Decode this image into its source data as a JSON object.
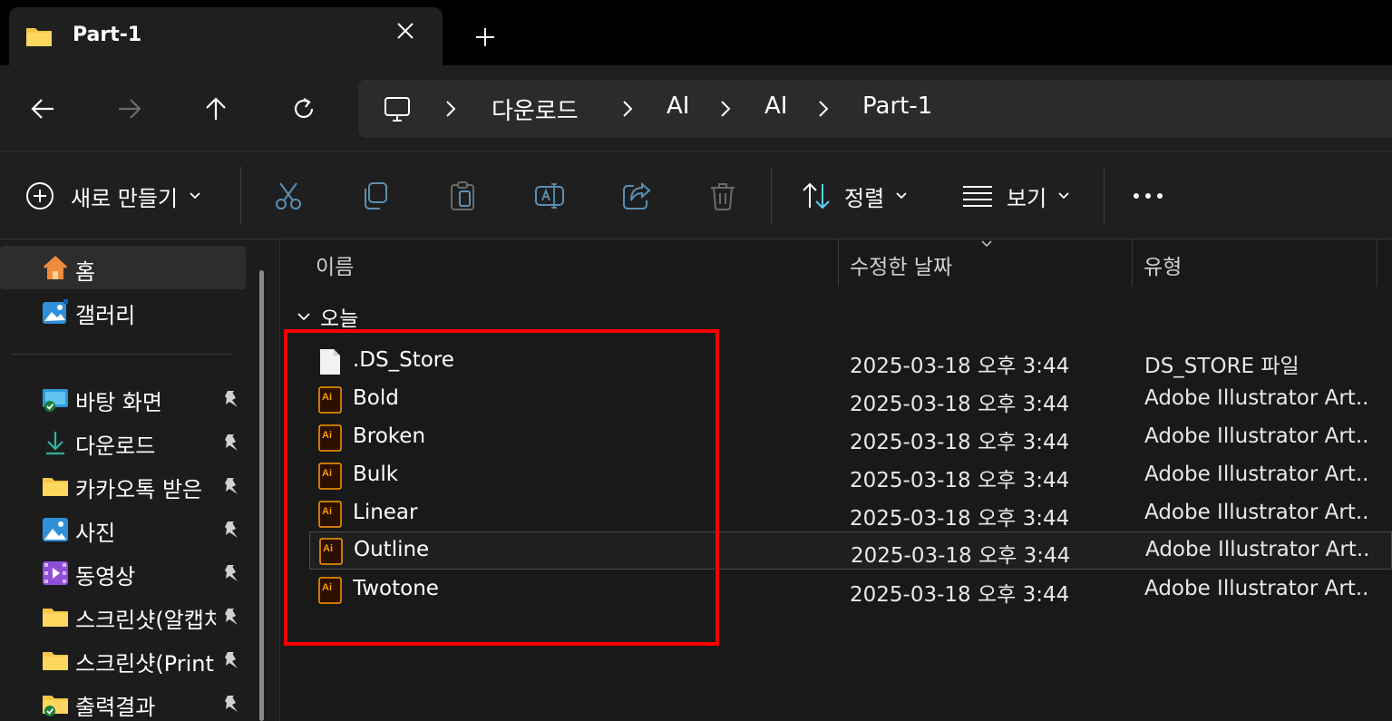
{
  "tab": {
    "title": "Part-1"
  },
  "address": {
    "crumbs": [
      "다운로드",
      "AI",
      "AI",
      "Part-1"
    ]
  },
  "toolbar": {
    "new_label": "새로 만들기",
    "sort_label": "정렬",
    "view_label": "보기"
  },
  "sidebar": {
    "items": [
      {
        "label": "홈",
        "icon": "home-icon"
      },
      {
        "label": "갤러리",
        "icon": "gallery-icon"
      },
      {
        "label": "바탕 화면",
        "icon": "desktop-icon"
      },
      {
        "label": "다운로드",
        "icon": "download-icon"
      },
      {
        "label": "카카오톡 받은",
        "icon": "folder-icon"
      },
      {
        "label": "사진",
        "icon": "pictures-icon"
      },
      {
        "label": "동영상",
        "icon": "videos-icon"
      },
      {
        "label": "스크린샷(알캡처",
        "icon": "folder-icon"
      },
      {
        "label": "스크린샷(Print",
        "icon": "folder-icon"
      },
      {
        "label": "출력결과",
        "icon": "folder-synced-icon"
      }
    ]
  },
  "columns": {
    "name": "이름",
    "date": "수정한 날짜",
    "type": "유형"
  },
  "group": {
    "label": "오늘"
  },
  "files": [
    {
      "name": ".DS_Store",
      "date": "2025-03-18 오후 3:44",
      "type": "DS_STORE 파일",
      "icon": "generic-file-icon"
    },
    {
      "name": "Bold",
      "date": "2025-03-18 오후 3:44",
      "type": "Adobe Illustrator Art...",
      "icon": "illustrator-file-icon"
    },
    {
      "name": "Broken",
      "date": "2025-03-18 오후 3:44",
      "type": "Adobe Illustrator Art...",
      "icon": "illustrator-file-icon"
    },
    {
      "name": "Bulk",
      "date": "2025-03-18 오후 3:44",
      "type": "Adobe Illustrator Art...",
      "icon": "illustrator-file-icon"
    },
    {
      "name": "Linear",
      "date": "2025-03-18 오후 3:44",
      "type": "Adobe Illustrator Art...",
      "icon": "illustrator-file-icon"
    },
    {
      "name": "Outline",
      "date": "2025-03-18 오후 3:44",
      "type": "Adobe Illustrator Art...",
      "icon": "illustrator-file-icon"
    },
    {
      "name": "Twotone",
      "date": "2025-03-18 오후 3:44",
      "type": "Adobe Illustrator Art...",
      "icon": "illustrator-file-icon"
    }
  ],
  "colors": {
    "accent": "#60cdff",
    "folder": "#f8c645",
    "illustrator": "#ff9a00",
    "highlight": "#ff0000"
  }
}
